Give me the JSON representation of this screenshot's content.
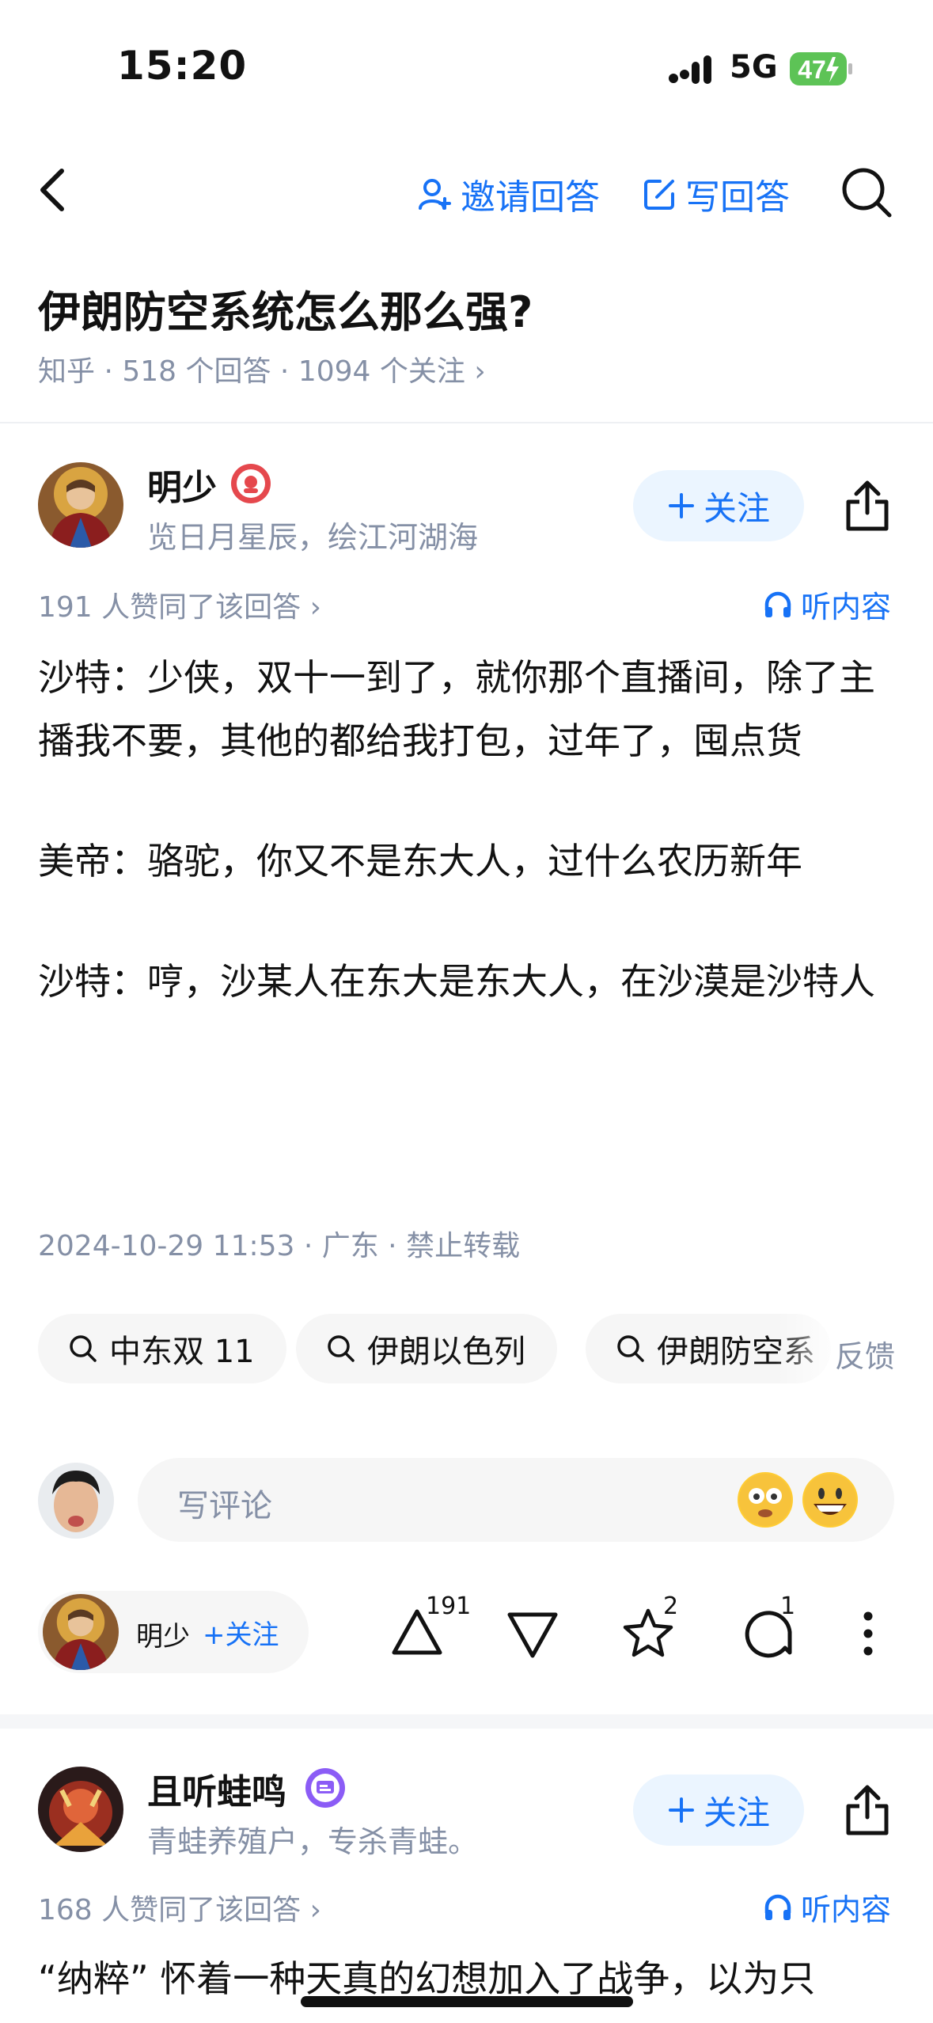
{
  "status_bar": {
    "time": "15:20",
    "network": "5G",
    "battery": "47"
  },
  "nav": {
    "invite_label": "邀请回答",
    "write_label": "写回答"
  },
  "question": {
    "title": "伊朗防空系统怎么那么强?",
    "meta": "知乎 · 518 个回答 · 1094 个关注 ›"
  },
  "answer1": {
    "author": "明少",
    "bio": "览日月星辰，绘江河湖海",
    "follow_label": "关注",
    "upvote_summary": "191 人赞同了该回答 ›",
    "listen_label": "听内容",
    "paragraphs": [
      "沙特：少侠，双十一到了，就你那个直播间，除了主播我不要，其他的都给我打包，过年了，囤点货",
      "美帝：骆驼，你又不是东大人，过什么农历新年",
      "沙特：哼，沙某人在东大是东大人，在沙漠是沙特人"
    ],
    "meta": "2024-10-29 11:53 · 广东 · 禁止转载",
    "tags": [
      "中东双 11",
      "伊朗以色列",
      "伊朗防空系"
    ],
    "feedback_label": "反馈",
    "comment_placeholder": "写评论",
    "bar": {
      "author": "明少",
      "follow_label": "+关注",
      "upvotes": "191",
      "favorites": "2",
      "comments": "1"
    }
  },
  "answer2": {
    "author": "且听蛙鸣",
    "bio": "青蛙养殖户，专杀青蛙。",
    "follow_label": "关注",
    "upvote_summary": "168 人赞同了该回答 ›",
    "listen_label": "听内容",
    "preview": "“纳粹” 怀着一种天真的幻想加入了战争，以为只"
  },
  "colors": {
    "accent": "#1772f6",
    "muted": "#8590a6",
    "text": "#121212"
  },
  "icons": [
    "back-arrow-icon",
    "invite-user-icon",
    "edit-icon",
    "search-icon",
    "badge-icon",
    "share-icon",
    "headphones-icon",
    "upvote-icon",
    "downvote-icon",
    "star-icon",
    "comment-icon",
    "more-icon"
  ]
}
